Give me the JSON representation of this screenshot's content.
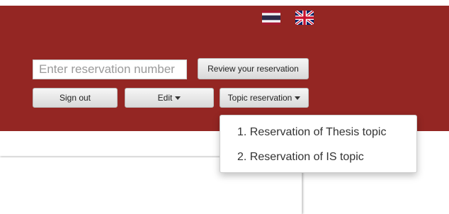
{
  "colors": {
    "brand": "#942623"
  },
  "header": {
    "flags": [
      {
        "name": "thai-flag-icon",
        "language": "Thai"
      },
      {
        "name": "uk-flag-icon",
        "language": "English"
      }
    ],
    "reservation_input": {
      "placeholder": "Enter reservation number",
      "value": ""
    },
    "review_button": "Review your reservation",
    "sign_out_button": "Sign out",
    "edit_button": "Edit",
    "topic_button": "Topic reservation"
  },
  "topic_menu": {
    "items": [
      {
        "label": "1. Reservation of Thesis topic"
      },
      {
        "label": "2. Reservation of IS topic"
      }
    ]
  }
}
